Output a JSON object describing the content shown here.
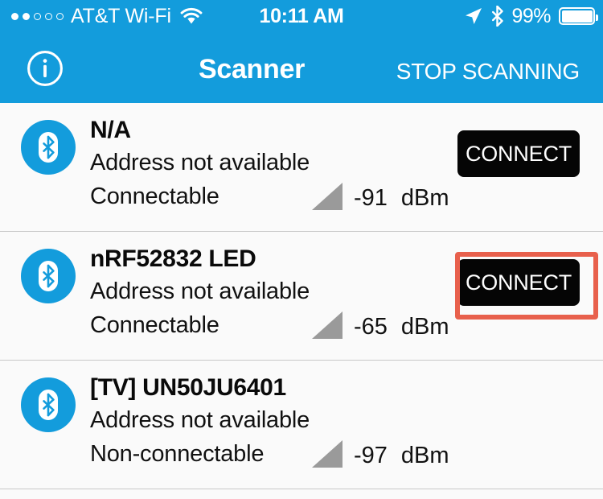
{
  "status_bar": {
    "signal_dots": [
      true,
      true,
      false,
      false,
      false
    ],
    "carrier": "AT&T Wi-Fi",
    "wifi_icon": "wifi-icon",
    "time": "10:11 AM",
    "location_icon": "location-arrow-icon",
    "bluetooth_icon": "bluetooth-icon",
    "battery_percent": "99%",
    "battery_icon": "battery-full-icon"
  },
  "nav_bar": {
    "info_icon": "info-circle-icon",
    "title": "Scanner",
    "action_label": "STOP SCANNING",
    "background_color": "#139CDC"
  },
  "list": {
    "devices": [
      {
        "icon": "bluetooth-device-icon",
        "name": "N/A",
        "address": "Address not available",
        "connectable": "Connectable",
        "rssi": "-91",
        "rssi_unit": "dBm",
        "signal_icon": "signal-strength-icon",
        "connect_label": "CONNECT",
        "has_connect": true,
        "highlighted": false
      },
      {
        "icon": "bluetooth-device-icon",
        "name": "nRF52832 LED",
        "address": "Address not available",
        "connectable": "Connectable",
        "rssi": "-65",
        "rssi_unit": "dBm",
        "signal_icon": "signal-strength-icon",
        "connect_label": "CONNECT",
        "has_connect": true,
        "highlighted": true
      },
      {
        "icon": "bluetooth-device-icon",
        "name": "[TV] UN50JU6401",
        "address": "Address not available",
        "connectable": "Non-connectable",
        "rssi": "-97",
        "rssi_unit": "dBm",
        "signal_icon": "signal-strength-icon",
        "connect_label": "",
        "has_connect": false,
        "highlighted": false
      }
    ]
  },
  "annotation": {
    "target": "connect-button-row-2",
    "color": "#E8604C"
  },
  "colors": {
    "accent_blue": "#139CDC",
    "button_black": "#050505",
    "annotation_red": "#E8604C",
    "signal_gray": "#9A9A9A",
    "background": "#FAFAFA"
  }
}
